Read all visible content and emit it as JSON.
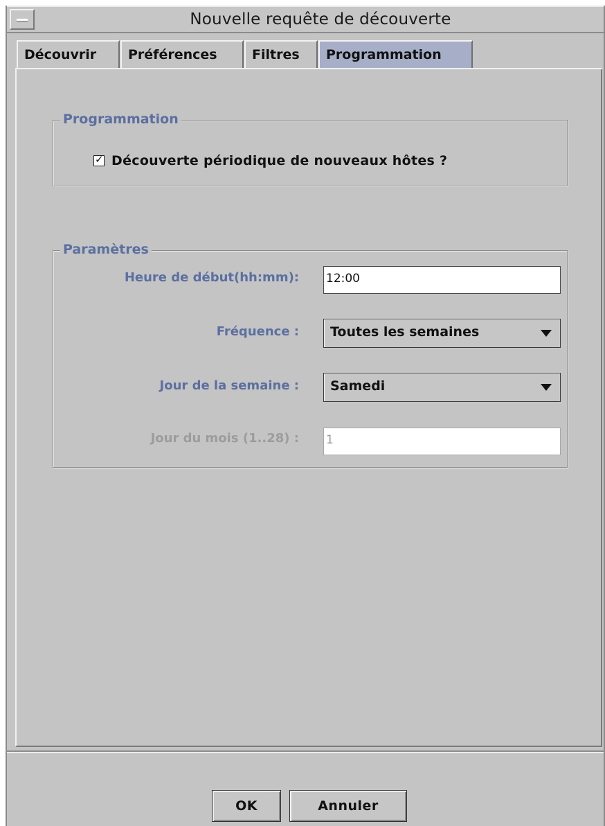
{
  "window": {
    "title": "Nouvelle requête de découverte"
  },
  "tabs": [
    {
      "label": "Découvrir",
      "active": false
    },
    {
      "label": "Préférences",
      "active": false
    },
    {
      "label": "Filtres",
      "active": false
    },
    {
      "label": "Programmation",
      "active": true
    }
  ],
  "programmation": {
    "group_title": "Programmation",
    "periodic_checkbox": {
      "label": "Découverte périodique de nouveaux hôtes ?",
      "checked": true,
      "check_glyph": "✓"
    }
  },
  "parametres": {
    "group_title": "Paramètres",
    "start_time": {
      "label": "Heure de début(hh:mm):",
      "value": "12:00"
    },
    "frequency": {
      "label": "Fréquence :",
      "selected": "Toutes les semaines"
    },
    "weekday": {
      "label": "Jour de la semaine :",
      "selected": "Samedi"
    },
    "month_day": {
      "label": "Jour du mois (1..28) :",
      "value": "1",
      "enabled": false
    }
  },
  "buttons": {
    "ok_label": "OK",
    "cancel_label": "Annuler"
  },
  "colors": {
    "window_bg": "#c4c4c4",
    "active_tab_bg": "#a7afc8",
    "label_blue": "#5b6fa1",
    "disabled_text": "#9c9c9c"
  },
  "icons": {
    "system_menu": "window-menu-icon",
    "dropdown": "chevron-down-icon",
    "checkmark": "checkmark-icon"
  }
}
